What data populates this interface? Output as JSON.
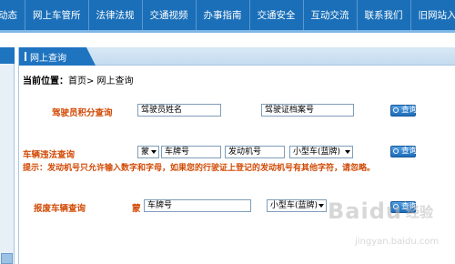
{
  "topnav": {
    "items": [
      "动态",
      "网上车管所",
      "法律法规",
      "交通视频",
      "办事指南",
      "交通安全",
      "互动交流",
      "联系我们",
      "旧网站入口"
    ]
  },
  "panel": {
    "title": "网上查询"
  },
  "breadcrumb": {
    "prefix": "当前位置：",
    "path": "首页> 网上查询"
  },
  "driver_points": {
    "label": "驾驶员积分查询",
    "name_value": "驾驶员姓名",
    "license_value": "驾驶证档案号",
    "button": "查询"
  },
  "violation": {
    "label": "车辆违法查询",
    "province": "蒙",
    "plate_value": "车牌号",
    "engine_value": "发动机号",
    "vehicle_type": "小型车(蓝牌)",
    "button": "查询",
    "tip": "提示：发动机号只允许输入数字和字母，如果您的行驶证上登记的发动机号有其他字符，请忽略。"
  },
  "scrap": {
    "label": "报废车辆查询",
    "province": "蒙",
    "plate_value": "车牌号",
    "vehicle_type": "小型车(蓝牌)",
    "button": "查询"
  },
  "watermark": {
    "brand": "Baidu",
    "brand_cn": "经验",
    "url": "jingyan.baidu.com"
  },
  "colors": {
    "nav_blue": "#1a6fb8",
    "label_orange": "#d14a05"
  }
}
